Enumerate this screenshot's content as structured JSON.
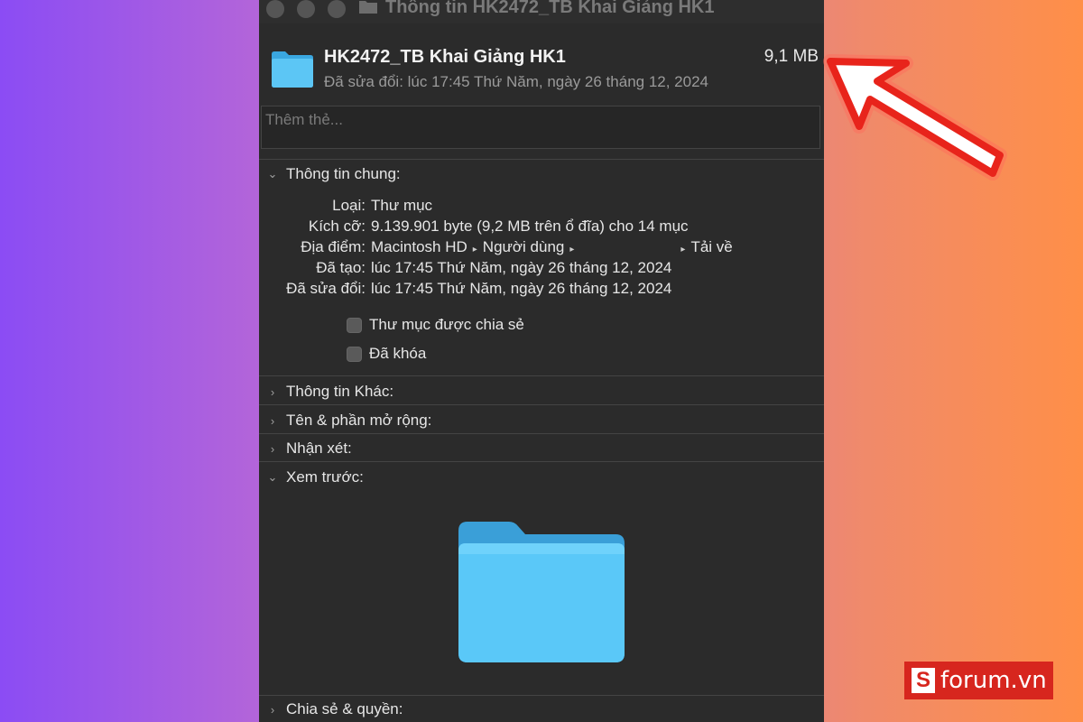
{
  "window": {
    "title": "Thông tin HK2472_TB Khai Giảng HK1",
    "traffic_lights": [
      "close",
      "minimize",
      "zoom"
    ]
  },
  "header": {
    "name": "HK2472_TB Khai Giảng HK1",
    "size": "9,1 MB",
    "modified": "Đã sửa đổi: lúc 17:45 Thứ Năm, ngày 26 tháng 12, 2024",
    "icon": "folder-icon"
  },
  "tags": {
    "placeholder": "Thêm thẻ..."
  },
  "general": {
    "title": "Thông tin chung:",
    "expanded": true,
    "rows": [
      {
        "key": "Loại:",
        "value": "Thư mục"
      },
      {
        "key": "Kích cỡ:",
        "value": "9.139.901 byte (9,2 MB trên ổ đĩa) cho 14 mục"
      },
      {
        "key": "Địa điểm:",
        "path": [
          "Macintosh HD",
          "Người dùng",
          "Tải về"
        ]
      },
      {
        "key": "Đã tạo:",
        "value": "lúc 17:45 Thứ Năm, ngày 26 tháng 12, 2024"
      },
      {
        "key": "Đã sửa đổi:",
        "value": "lúc 17:45 Thứ Năm, ngày 26 tháng 12, 2024"
      }
    ],
    "checkboxes": [
      {
        "label": "Thư mục được chia sẻ",
        "checked": false
      },
      {
        "label": "Đã khóa",
        "checked": false
      }
    ]
  },
  "sections": {
    "more_info": "Thông tin Khác:",
    "name_ext": "Tên & phần mở rộng:",
    "comments": "Nhận xét:",
    "preview": "Xem trước:",
    "sharing": "Chia sẻ & quyền:"
  },
  "branding": {
    "text": "forum.vn",
    "logo_letter": "S"
  },
  "colors": {
    "panel": "#2b2b2b",
    "folder_blue": "#4fc3f7",
    "annotation_arrow": "#e8241b",
    "brand_red": "#d7261e"
  }
}
